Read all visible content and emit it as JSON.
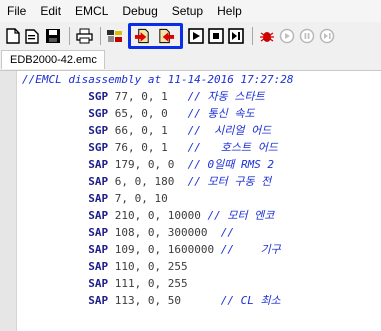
{
  "menu": [
    "File",
    "Edit",
    "EMCL",
    "Debug",
    "Setup",
    "Help"
  ],
  "toolbar": {
    "buttons": [
      {
        "icon": "new-file-icon"
      },
      {
        "icon": "open-file-icon"
      },
      {
        "icon": "save-icon"
      },
      {
        "icon": "print-icon"
      },
      {
        "icon": "compile-icon"
      },
      {
        "icon": "download-to-module-icon"
      },
      {
        "icon": "upload-from-module-icon"
      },
      {
        "icon": "run-icon"
      },
      {
        "icon": "stop-icon"
      },
      {
        "icon": "step-icon"
      },
      {
        "icon": "bug-icon"
      },
      {
        "icon": "circle-button-1-icon"
      },
      {
        "icon": "circle-button-2-icon"
      },
      {
        "icon": "circle-button-3-icon"
      }
    ],
    "highlight_color": "#0a2ee8"
  },
  "tab": {
    "label": "EDB2000-42.emc"
  },
  "editor": {
    "lines": [
      {
        "indent": "",
        "cmd": "",
        "args": "",
        "comment": "//EMCL disassembly at 11-14-2016 17:27:28"
      },
      {
        "indent": "          ",
        "cmd": "SGP",
        "args": " 77, 0, 1   ",
        "comment": "// 자동 스타트"
      },
      {
        "indent": "          ",
        "cmd": "SGP",
        "args": " 65, 0, 0   ",
        "comment": "// 통신 속도"
      },
      {
        "indent": "          ",
        "cmd": "SGP",
        "args": " 66, 0, 1   ",
        "comment": "//  시리얼 어드"
      },
      {
        "indent": "          ",
        "cmd": "SGP",
        "args": " 76, 0, 1   ",
        "comment": "//   호스트 어드"
      },
      {
        "indent": "          ",
        "cmd": "SAP",
        "args": " 179, 0, 0  ",
        "comment": "// 0일때 RMS 2"
      },
      {
        "indent": "          ",
        "cmd": "SAP",
        "args": " 6, 0, 180  ",
        "comment": "// 모터 구동 전"
      },
      {
        "indent": "          ",
        "cmd": "SAP",
        "args": " 7, 0, 10",
        "comment": ""
      },
      {
        "indent": "          ",
        "cmd": "SAP",
        "args": " 210, 0, 10000 ",
        "comment": "// 모터 엔코"
      },
      {
        "indent": "          ",
        "cmd": "SAP",
        "args": " 108, 0, 300000  ",
        "comment": "//"
      },
      {
        "indent": "          ",
        "cmd": "SAP",
        "args": " 109, 0, 1600000 ",
        "comment": "//    기구"
      },
      {
        "indent": "          ",
        "cmd": "SAP",
        "args": " 110, 0, 255",
        "comment": ""
      },
      {
        "indent": "          ",
        "cmd": "SAP",
        "args": " 111, 0, 255",
        "comment": ""
      },
      {
        "indent": "          ",
        "cmd": "SAP",
        "args": " 113, 0, 50      ",
        "comment": "// CL 최소"
      }
    ]
  }
}
